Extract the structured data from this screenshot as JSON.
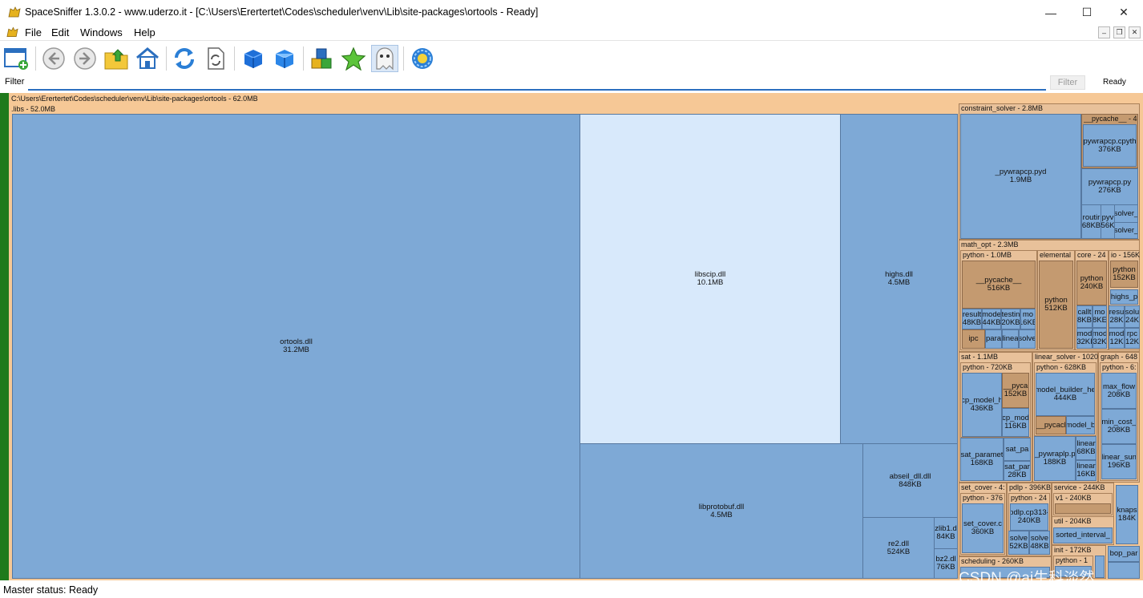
{
  "window": {
    "title": "SpaceSniffer 1.3.0.2 - www.uderzo.it - [C:\\Users\\Erertertet\\Codes\\scheduler\\venv\\Lib\\site-packages\\ortools - Ready]",
    "minimize": "—",
    "maximize": "☐",
    "close": "✕"
  },
  "menu": {
    "file": "File",
    "edit": "Edit",
    "windows": "Windows",
    "help": "Help"
  },
  "mdi": {
    "min": "–",
    "restore": "❐",
    "close": "✕"
  },
  "filter": {
    "label": "Filter",
    "value": "",
    "button": "Filter",
    "status": "Ready"
  },
  "map": {
    "root_label": "C:\\Users\\Erertertet\\Codes\\scheduler\\venv\\Lib\\site-packages\\ortools - 62.0MB",
    "libs_label": ".libs - 52.0MB",
    "ortools": {
      "name": "ortools.dll",
      "size": "31.2MB"
    },
    "libscip": {
      "name": "libscip.dll",
      "size": "10.1MB"
    },
    "highs": {
      "name": "highs.dll",
      "size": "4.5MB"
    },
    "libprotobuf": {
      "name": "libprotobuf.dll",
      "size": "4.5MB"
    },
    "abseil": {
      "name": "abseil_dll.dll",
      "size": "848KB"
    },
    "re2": {
      "name": "re2.dll",
      "size": "524KB"
    },
    "zlib": {
      "name": "zlib1.d",
      "size": "84KB"
    },
    "bz2": {
      "name": "bz2.dl",
      "size": "76KB"
    },
    "constraint_solver": "constraint_solver - 2.8MB",
    "cs_pycache": "__pycache__ - 4",
    "pywrapcp_pyd": {
      "name": "_pywrapcp.pyd",
      "size": "1.9MB"
    },
    "pywrapcp_cpyth": {
      "name": "pywrapcp.cpyth",
      "size": "376KB"
    },
    "pywrapcp_py": {
      "name": "pywrapcp.py",
      "size": "276KB"
    },
    "routir": {
      "name": "routir",
      "size": "68KB"
    },
    "pyv": {
      "name": "pyv",
      "size": "56K"
    },
    "solver1": {
      "name": "solver_"
    },
    "solver2": {
      "name": "solver_"
    },
    "math_opt": "math_opt - 2.3MB",
    "mo_python": "python - 1.0MB",
    "mo_elemental": "elemental",
    "mo_core": "core - 24",
    "mo_io": "io - 156K",
    "mo_pycache": {
      "name": "__pycache__",
      "size": "516KB"
    },
    "result": {
      "name": "result",
      "size": "48KB"
    },
    "mode": {
      "name": "mode",
      "size": "44KB"
    },
    "testin": {
      "name": "testin",
      "size": "20KB"
    },
    "mo4": {
      "name": "mo",
      "size": "16KB"
    },
    "ipc": {
      "name": "ipc"
    },
    "para": {
      "name": "para"
    },
    "linea": {
      "name": "linea"
    },
    "solve": {
      "name": "solve"
    },
    "el_python": {
      "name": "python",
      "size": "512KB"
    },
    "core_python": {
      "name": "python",
      "size": "240KB"
    },
    "io_python": {
      "name": "python",
      "size": "152KB"
    },
    "highs_p": {
      "name": "highs_p"
    },
    "callt": {
      "name": "callt",
      "size": "8KB"
    },
    "mod_c1": {
      "name": "mo",
      "size": "8KE"
    },
    "resu": {
      "name": "resu",
      "size": "28K"
    },
    "solu": {
      "name": "solu",
      "size": "24K"
    },
    "mod_c2": {
      "name": "mod",
      "size": "32KI"
    },
    "mod_c3": {
      "name": "mod",
      "size": "32K"
    },
    "mod_c4": {
      "name": "mod",
      "size": "12K"
    },
    "rpc": {
      "name": "rpc",
      "size": "12K"
    },
    "sat": "sat - 1.1MB",
    "sat_python": "python - 720KB",
    "cp_model_h": {
      "name": "cp_model_h",
      "size": "436KB"
    },
    "sat_pyca": {
      "name": "__pyca",
      "size": "152KB"
    },
    "cp_mod": {
      "name": "cp_mod",
      "size": "116KB"
    },
    "sat_param": {
      "name": "sat_paramet",
      "size": "168KB"
    },
    "sat_pa1": {
      "name": "sat_pa"
    },
    "sat_pa2": {
      "name": "sat_par",
      "size": "28KB"
    },
    "linear_solver": "linear_solver - 1020",
    "ls_python": "python - 628KB",
    "model_builder": {
      "name": "model_builder_he",
      "size": "444KB"
    },
    "ls_pycacl": {
      "name": "__pycacl"
    },
    "model_b": {
      "name": "model_b"
    },
    "pywraplp": {
      "name": "_pywraplp.p",
      "size": "188KB"
    },
    "linear1": {
      "name": "linear",
      "size": "68KB"
    },
    "linear2": {
      "name": "linear",
      "size": "16KB"
    },
    "graph": "graph - 648",
    "gr_python": "python - 6:",
    "max_flow": {
      "name": "max_flow",
      "size": "208KB"
    },
    "min_cost": {
      "name": "min_cost_",
      "size": "208KB"
    },
    "linear_sum": {
      "name": "linear_sun",
      "size": "196KB"
    },
    "set_cover": "set_cover - 4:",
    "sc_python": "python - 376",
    "set_cover_c": {
      "name": "set_cover.c",
      "size": "360KB"
    },
    "pdlp": "pdlp - 396KB",
    "pdlp_python": "python - 24",
    "pdlp_cp": {
      "name": "pdlp.cp313-",
      "size": "240KB"
    },
    "pdlp_solve1": {
      "name": "solve",
      "size": "52KB"
    },
    "pdlp_solve2": {
      "name": "solve",
      "size": "48KB"
    },
    "service": "service - 244KB",
    "v1": "v1 - 240KB",
    "util": "util - 204KB",
    "sorted_interval": {
      "name": "sorted_interval_"
    },
    "init": "init - 172KB",
    "init_python": "python - 1",
    "knaps": {
      "name": "knaps",
      "size": "184K"
    },
    "bop_par": {
      "name": "bop_par"
    },
    "scheduling": "scheduling - 260KB"
  },
  "status": {
    "text": "Master status: Ready"
  },
  "watermark": "CSDN @ai生科淡然"
}
